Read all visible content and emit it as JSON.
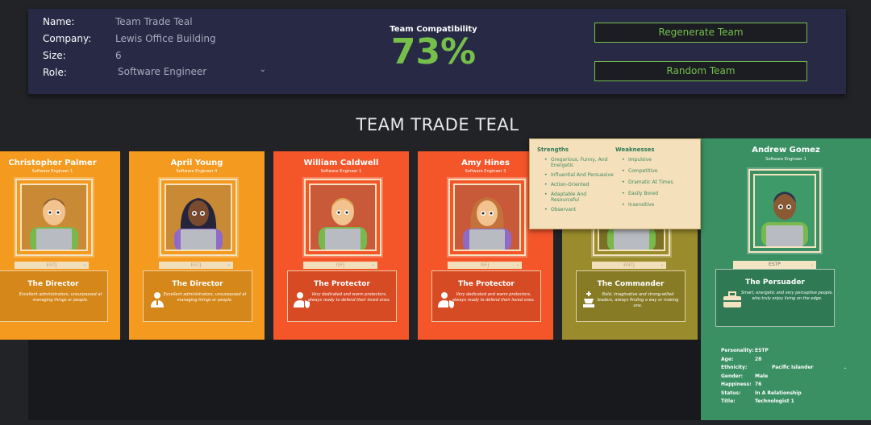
{
  "header": {
    "fields": [
      {
        "label": "Name:",
        "value": "Team Trade Teal"
      },
      {
        "label": "Company:",
        "value": "Lewis Office Building"
      },
      {
        "label": "Size:",
        "value": "6"
      },
      {
        "label": "Role:",
        "value": "Software Engineer"
      }
    ],
    "compatibility_label": "Team Compatibility",
    "compatibility_value": "73%",
    "regenerate_label": "Regenerate Team",
    "random_label": "Random Team"
  },
  "team_title": "TEAM TRADE TEAL",
  "cards": [
    {
      "name": "Christopher Palmer",
      "role": "Software Engineer 1",
      "type": "ESTJ",
      "persona": "The Director",
      "desc": "Excellent administrators, unsurpassed at managing things or people.",
      "color": "#f49a1e",
      "icon": "director-icon"
    },
    {
      "name": "April Young",
      "role": "Software Engineer 4",
      "type": "ESTJ",
      "persona": "The Director",
      "desc": "Excellent administrators, unsurpassed at managing things or people.",
      "color": "#f49a1e",
      "icon": "director-icon"
    },
    {
      "name": "William Caldwell",
      "role": "Software Engineer 1",
      "type": "ISFJ",
      "persona": "The Protector",
      "desc": "Very dedicated and warm protectors, always ready to defend their loved ones.",
      "color": "#f4562a",
      "icon": "protector-icon"
    },
    {
      "name": "Amy Hines",
      "role": "Software Engineer 3",
      "type": "ISFJ",
      "persona": "The Protector",
      "desc": "Very dedicated and warm protectors, always ready to defend their loved ones.",
      "color": "#f4562a",
      "icon": "protector-icon"
    },
    {
      "name": "",
      "role": "",
      "type": "ENTJ",
      "persona": "The Commander",
      "desc": "Bold, imaginative and strong-willed leaders, always finding a way or making one.",
      "color": "#9a8c2c",
      "icon": "commander-icon"
    }
  ],
  "tooltip": {
    "strengths_title": "Strengths",
    "strengths": [
      "Gregarious, Funny, And Energetic",
      "Influential And Persuasive",
      "Action-Oriented",
      "Adaptable And Resourceful",
      "Observant"
    ],
    "weaknesses_title": "Weaknesses",
    "weaknesses": [
      "Impulsive",
      "Competitive",
      "Dramatic At Times",
      "Easily Bored",
      "Insensitive"
    ]
  },
  "selected": {
    "name": "Andrew Gomez",
    "role": "Software Engineer 1",
    "type": "ESTP",
    "persona": "The Persuader",
    "desc": "Smart, energetic and very perceptive people, who truly enjoy living on the edge.",
    "details": [
      {
        "key": "Personality:",
        "value": "ESTP"
      },
      {
        "key": "Age:",
        "value": "28"
      },
      {
        "key": "Ethnicity:",
        "value": "Pacific Islander"
      },
      {
        "key": "Gender:",
        "value": "Male"
      },
      {
        "key": "Happiness:",
        "value": "76"
      },
      {
        "key": "Status:",
        "value": "In A Relationship"
      },
      {
        "key": "Title:",
        "value": "Technologist 1"
      }
    ]
  }
}
